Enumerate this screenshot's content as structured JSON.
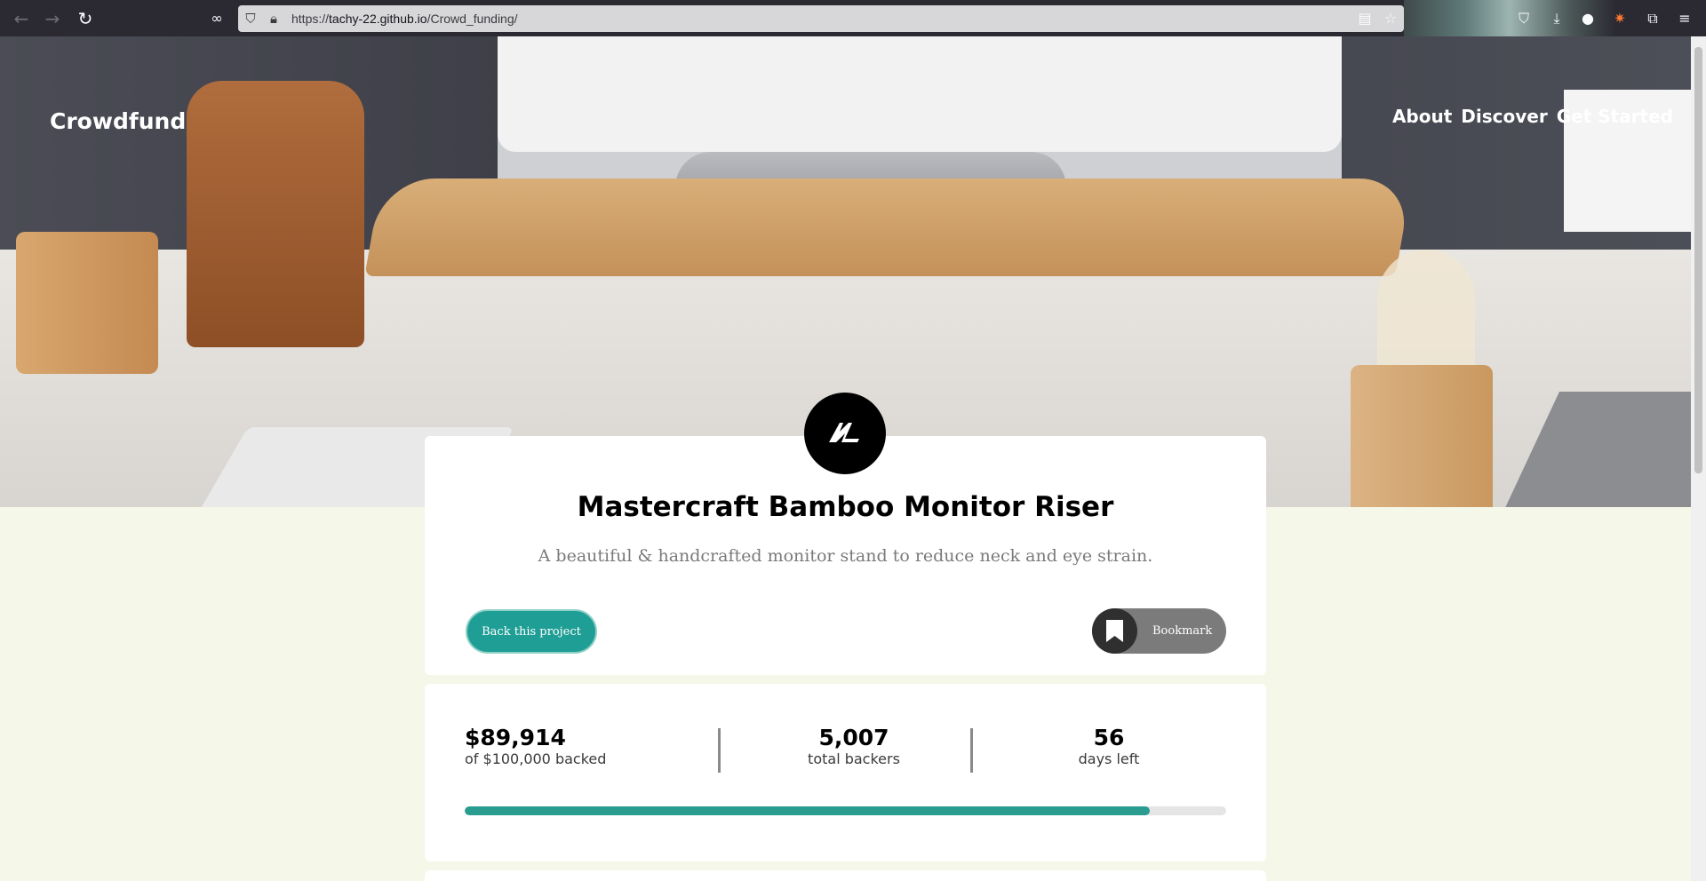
{
  "browser": {
    "url_prefix": "https://",
    "url_host": "tachy-22.github.io",
    "url_path": "/Crowd_funding/"
  },
  "header": {
    "brand": "Crowdfund",
    "nav": [
      "About",
      "Discover",
      "Get Started"
    ]
  },
  "project": {
    "title": "Mastercraft Bamboo Monitor Riser",
    "subtitle": "A beautiful & handcrafted monitor stand to reduce neck and eye strain.",
    "back_label": "Back this project",
    "bookmark_label": "Bookmark"
  },
  "stats": {
    "backed_amount": "$89,914",
    "backed_label": "of $100,000 backed",
    "backers_count": "5,007",
    "backers_label": "total backers",
    "days_count": "56",
    "days_label": "days left",
    "progress_fraction": 0.89914
  },
  "colors": {
    "accent": "#1f9e95",
    "page_bg": "#f5f7e8"
  }
}
